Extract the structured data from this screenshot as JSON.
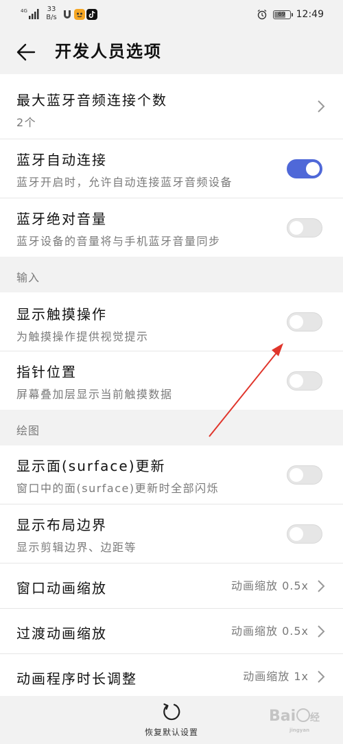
{
  "status_bar": {
    "network_label": "4G",
    "speed_value": "33",
    "speed_unit": "B/s",
    "battery_level": "69",
    "time": "12:49"
  },
  "header": {
    "title": "开发人员选项"
  },
  "bluetooth": {
    "max_audio": {
      "title": "最大蓝牙音频连接个数",
      "subtitle": "2个"
    },
    "auto_connect": {
      "title": "蓝牙自动连接",
      "subtitle": "蓝牙开启时，允许自动连接蓝牙音频设备",
      "enabled": true
    },
    "absolute_volume": {
      "title": "蓝牙绝对音量",
      "subtitle": "蓝牙设备的音量将与手机蓝牙音量同步",
      "enabled": false
    }
  },
  "input_section": {
    "header": "输入",
    "show_taps": {
      "title": "显示触摸操作",
      "subtitle": "为触摸操作提供视觉提示",
      "enabled": false
    },
    "pointer_location": {
      "title": "指针位置",
      "subtitle": "屏幕叠加层显示当前触摸数据",
      "enabled": false
    }
  },
  "drawing_section": {
    "header": "绘图",
    "surface_updates": {
      "title": "显示面(surface)更新",
      "subtitle": "窗口中的面(surface)更新时全部闪烁",
      "enabled": false
    },
    "layout_bounds": {
      "title": "显示布局边界",
      "subtitle": "显示剪辑边界、边距等",
      "enabled": false
    },
    "window_animation": {
      "title": "窗口动画缩放",
      "value": "动画缩放 0.5x"
    },
    "transition_animation": {
      "title": "过渡动画缩放",
      "value": "动画缩放 0.5x"
    },
    "animator_duration": {
      "title": "动画程序时长调整",
      "value": "动画缩放 1x"
    }
  },
  "bottom_bar": {
    "reset_label": "恢复默认设置"
  },
  "colors": {
    "accent": "#4f68d8",
    "annotation_arrow": "#e0352b",
    "background": "#f2f2f2"
  }
}
